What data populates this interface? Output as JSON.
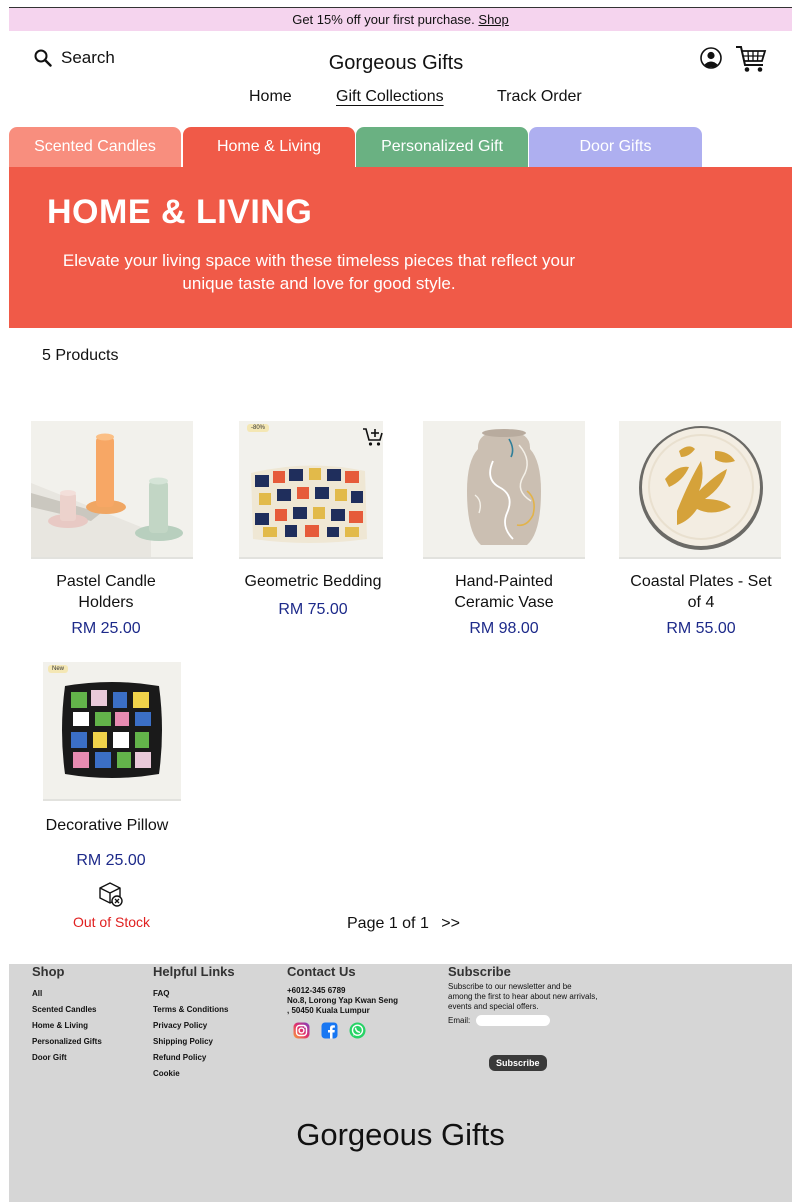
{
  "promo": {
    "text": "Get 15% off your first purchase.",
    "link": "Shop"
  },
  "header": {
    "search_label": "Search",
    "brand": "Gorgeous Gifts",
    "nav": [
      "Home",
      "Gift Collections",
      "Track Order"
    ]
  },
  "tabs": [
    {
      "label": "Scented Candles",
      "color": "#f88e7e"
    },
    {
      "label": "Home & Living",
      "color": "#f05a48"
    },
    {
      "label": "Personalized Gift",
      "color": "#6ab182"
    },
    {
      "label": "Door Gifts",
      "color": "#aeaff0"
    }
  ],
  "hero": {
    "title": "HOME & LIVING",
    "subtitle": "Elevate your living space with these timeless pieces that reflect your unique taste and love for good style."
  },
  "products_count": "5 Products",
  "products": [
    {
      "name": "Pastel Candle Holders",
      "price": "RM 25.00"
    },
    {
      "name": "Geometric Bedding",
      "price": "RM 75.00",
      "badge": "-80%"
    },
    {
      "name": "Hand-Painted Ceramic Vase",
      "price": "RM 98.00"
    },
    {
      "name": "Coastal Plates - Set of 4",
      "price": "RM 55.00"
    },
    {
      "name": "Decorative Pillow",
      "price": "RM 25.00",
      "badge": "New",
      "status": "Out of Stock"
    }
  ],
  "pagination": {
    "label": "Page 1 of 1",
    "next": ">>"
  },
  "footer": {
    "shop": {
      "title": "Shop",
      "links": [
        "All",
        "Scented Candles",
        "Home & Living",
        "Personalized Gifts",
        "Door Gift"
      ]
    },
    "helpful": {
      "title": "Helpful Links",
      "links": [
        "FAQ",
        "Terms & Conditions",
        "Privacy Policy",
        "Shipping Policy",
        "Refund Policy",
        "Cookie"
      ]
    },
    "contact": {
      "title": "Contact Us",
      "phone": "+6012-345 6789",
      "address": "No.8, Lorong Yap Kwan Seng , 50450 Kuala Lumpur"
    },
    "subscribe": {
      "title": "Subscribe",
      "text": "Subscribe to our newsletter and be among the first to hear about new arrivals, events and special offers.",
      "email_label": "Email:",
      "button": "Subscribe"
    },
    "brand": "Gorgeous Gifts"
  },
  "icons": {
    "search": "search-icon",
    "user": "user-icon",
    "cart": "cart-icon",
    "add_to_cart": "add-to-cart-icon",
    "out_of_stock": "box-x-icon",
    "social": [
      "instagram-icon",
      "facebook-icon",
      "whatsapp-icon"
    ]
  }
}
